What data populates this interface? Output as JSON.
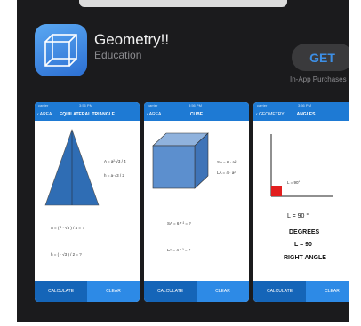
{
  "app": {
    "title": "Geometry!!",
    "category": "Education",
    "get_label": "GET",
    "in_app_purchases": "In-App Purchases"
  },
  "colors": {
    "accent": "#3d8fe6",
    "nav_blue": "#1e7ad4",
    "button_dark": "#1565b8",
    "background": "#1b1b1d"
  },
  "screenshots": [
    {
      "status_left": "carrier",
      "status_time": "3:56 PM",
      "status_right": "",
      "back": "AREA",
      "title": "EQUILATERAL TRIANGLE",
      "formula_area": "A = a²·√3 / 4",
      "formula_height": "h = a·√3 / 2",
      "calc_area": "A = ( ² · √3 ) / 4 = ?",
      "calc_height": "h = ( · √3 ) / 2 = ?",
      "calculate": "CALCULATE",
      "clear": "CLEAR"
    },
    {
      "status_left": "carrier",
      "status_time": "3:56 PM",
      "status_right": "",
      "back": "AREA",
      "title": "CUBE",
      "formula_sa": "SA = 6 · a²",
      "formula_la": "LA = 4 · a²",
      "calc_sa": "SA = 6 * ²  = ?",
      "calc_la": "LA = 4 * ²  = ?",
      "calculate": "CALCULATE",
      "clear": "CLEAR"
    },
    {
      "status_left": "carrier",
      "status_time": "3:56 PM",
      "status_right": "",
      "back": "GEOMETRY",
      "title": "ANGLES",
      "angle_label": "L = 90°",
      "l_value": "L =  90  °",
      "unit": "DEGREES",
      "result": "L = 90",
      "kind": "RIGHT ANGLE",
      "calculate": "CALCULATE",
      "clear": "CLEAR"
    }
  ]
}
